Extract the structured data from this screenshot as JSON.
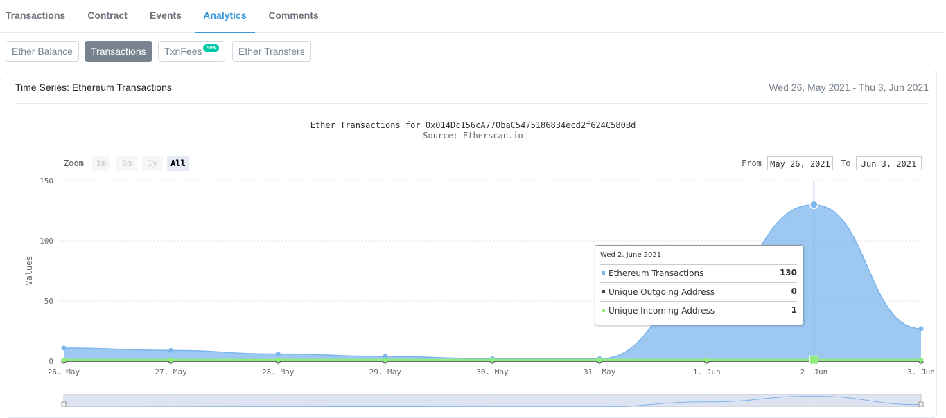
{
  "tabs": [
    {
      "label": "Transactions",
      "active": false
    },
    {
      "label": "Contract",
      "active": false
    },
    {
      "label": "Events",
      "active": false
    },
    {
      "label": "Analytics",
      "active": true
    },
    {
      "label": "Comments",
      "active": false
    }
  ],
  "subtabs": [
    {
      "label": "Ether Balance",
      "active": false
    },
    {
      "label": "Transactions",
      "active": true
    },
    {
      "label": "TxnFees",
      "badge": "New",
      "active": false
    },
    {
      "label": "Ether Transfers",
      "active": false
    }
  ],
  "card": {
    "title": "Time Series: Ethereum Transactions",
    "date_range": "Wed 26, May 2021 - Thu 3, Jun 2021"
  },
  "zoom": {
    "label": "Zoom",
    "options": [
      "1m",
      "6m",
      "1y",
      "All"
    ],
    "selected": "All"
  },
  "range": {
    "from_label": "From",
    "from_value": "May 26, 2021",
    "to_label": "To",
    "to_value": "Jun 3, 2021"
  },
  "tooltip": {
    "date": "Wed 2, June 2021",
    "rows": [
      {
        "name": "Ethereum Transactions",
        "value": "130",
        "color": "#7cb5ec"
      },
      {
        "name": "Unique Outgoing Address",
        "value": "0",
        "color": "#434348"
      },
      {
        "name": "Unique Incoming Address",
        "value": "1",
        "color": "#90ed7d"
      }
    ]
  },
  "chart_data": {
    "type": "area",
    "title": "Ether Transactions for 0x014Dc156cA770baC5475186834ecd2f624C580Bd",
    "subtitle": "Source: Etherscan.io",
    "ylabel": "Values",
    "ylim": [
      0,
      150
    ],
    "yticks": [
      0,
      50,
      100,
      150
    ],
    "x": [
      "26. May",
      "27. May",
      "28. May",
      "29. May",
      "30. May",
      "31. May",
      "1. Jun",
      "2. Jun",
      "3. Jun"
    ],
    "series": [
      {
        "name": "Ethereum Transactions",
        "color": "#7cb5ec",
        "values": [
          11,
          9,
          6,
          4,
          2,
          2,
          60,
          130,
          27
        ]
      },
      {
        "name": "Unique Outgoing Address",
        "color": "#434348",
        "values": [
          0,
          0,
          0,
          0,
          0,
          0,
          0,
          0,
          0
        ]
      },
      {
        "name": "Unique Incoming Address",
        "color": "#90ed7d",
        "values": [
          1,
          1,
          1,
          1,
          1,
          1,
          1,
          1,
          1
        ]
      }
    ],
    "highlighted_x": "2. Jun",
    "grid": true
  }
}
